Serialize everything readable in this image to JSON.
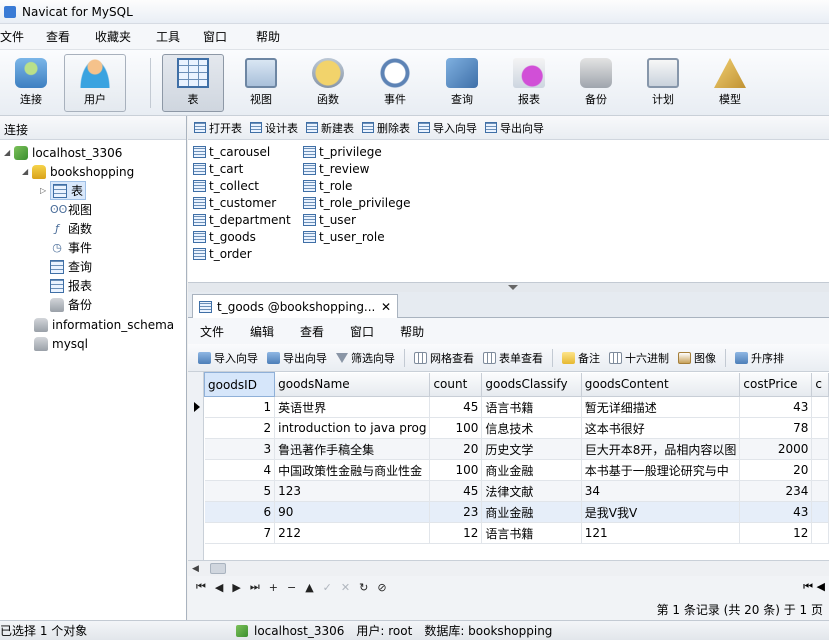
{
  "window": {
    "title": "Navicat for MySQL"
  },
  "menu": [
    "文件",
    "查看",
    "收藏夹",
    "工具",
    "窗口",
    "帮助"
  ],
  "toolbar": {
    "connect": "连接",
    "user": "用户",
    "table": "表",
    "view": "视图",
    "function": "函数",
    "event": "事件",
    "query": "查询",
    "report": "报表",
    "backup": "备份",
    "schedule": "计划",
    "model": "模型"
  },
  "sidebar": {
    "header": "连接",
    "connection": "localhost_3306",
    "database": "bookshopping",
    "items": [
      "表",
      "视图",
      "函数",
      "事件",
      "查询",
      "报表",
      "备份"
    ],
    "other_dbs": [
      "information_schema",
      "mysql"
    ]
  },
  "object_toolbar": [
    "打开表",
    "设计表",
    "新建表",
    "删除表",
    "导入向导",
    "导出向导"
  ],
  "tables_col1": [
    "t_carousel",
    "t_cart",
    "t_collect",
    "t_customer",
    "t_department",
    "t_goods",
    "t_order"
  ],
  "tables_col2": [
    "t_privilege",
    "t_review",
    "t_role",
    "t_role_privilege",
    "t_user",
    "t_user_role"
  ],
  "doc_tab": {
    "label": "t_goods @bookshopping...",
    "close": "✕"
  },
  "inner_menu": [
    "文件",
    "编辑",
    "查看",
    "窗口",
    "帮助"
  ],
  "inner_toolbar": [
    "导入向导",
    "导出向导",
    "筛选向导",
    "网格查看",
    "表单查看",
    "备注",
    "十六进制",
    "图像",
    "升序排"
  ],
  "grid": {
    "columns": [
      "goodsID",
      "goodsName",
      "count",
      "goodsClassify",
      "goodsContent",
      "costPrice",
      "c"
    ],
    "rows": [
      [
        "1",
        "英语世界",
        "45",
        "语言书籍",
        "暂无详细描述",
        "43"
      ],
      [
        "2",
        "introduction to java prog",
        "100",
        "信息技术",
        "这本书很好",
        "78"
      ],
      [
        "3",
        "鲁迅著作手稿全集",
        "20",
        "历史文学",
        "巨大开本8开，品相内容以图",
        "2000"
      ],
      [
        "4",
        "中国政策性金融与商业性金",
        "100",
        "商业金融",
        "本书基于一般理论研究与中",
        "20"
      ],
      [
        "5",
        "123",
        "45",
        "法律文献",
        "34",
        "234"
      ],
      [
        "6",
        "90",
        "23",
        "商业金融",
        "是我V我V",
        "43"
      ],
      [
        "7",
        "212",
        "12",
        "语言书籍",
        "121",
        "12"
      ]
    ]
  },
  "navbar": [
    "⏮",
    "◀",
    "▶",
    "⏭",
    "+",
    "−",
    "▲",
    "✓",
    "✕",
    "↻",
    "⊘"
  ],
  "navbar_right": "⏮ ◀",
  "pager": "第 1 条记录 (共 20 条) 于 1 页",
  "status": {
    "selection": "已选择 1 个对象",
    "host": "localhost_3306",
    "user": "用户: root",
    "database": "数据库: bookshopping"
  }
}
